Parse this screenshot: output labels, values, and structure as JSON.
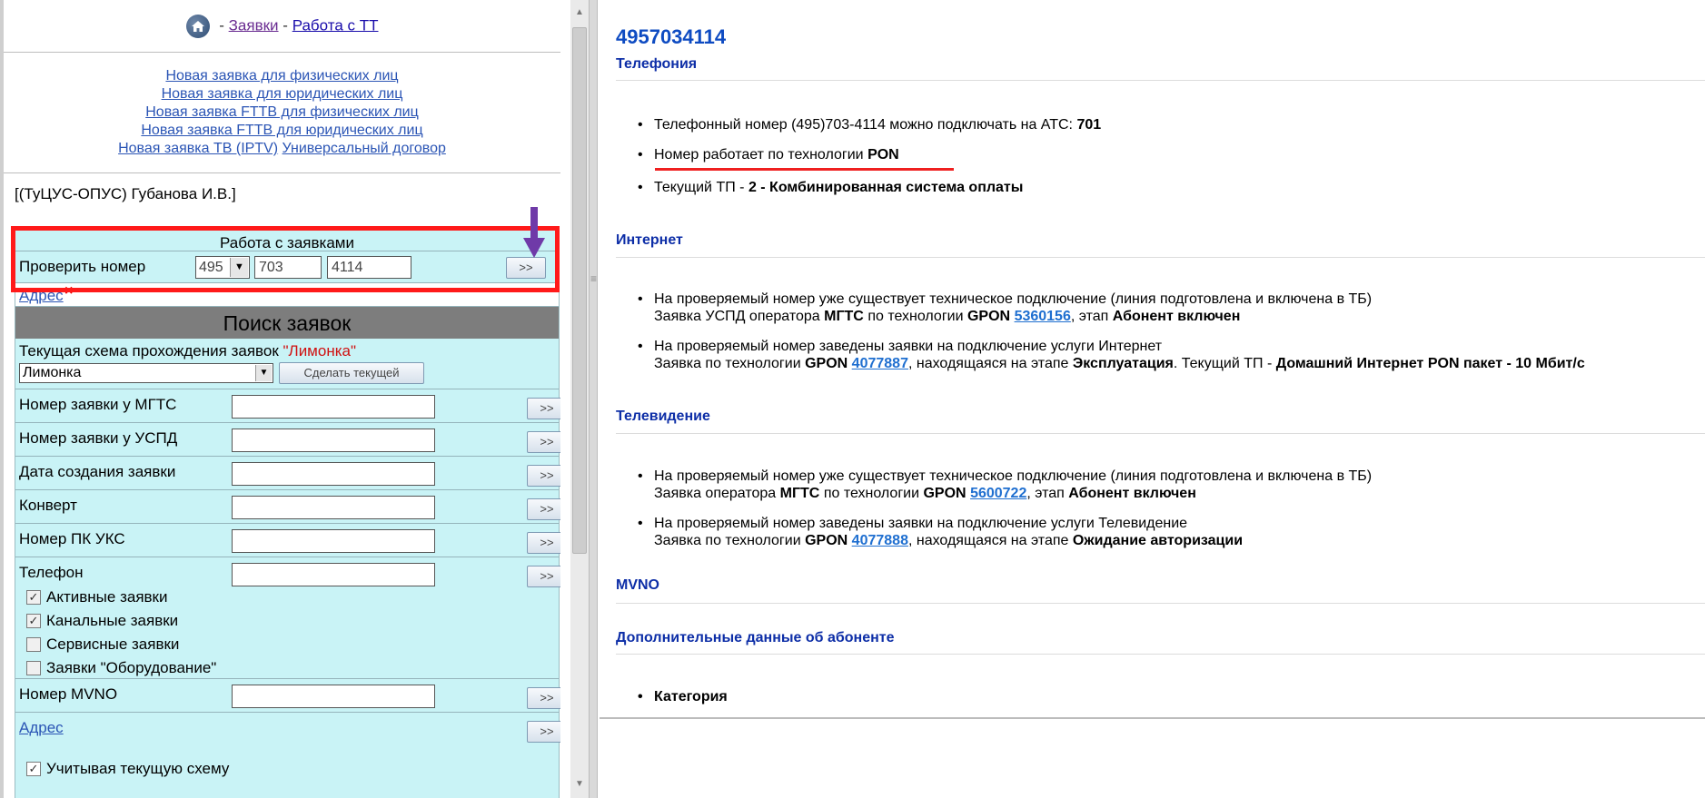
{
  "nav": {
    "sep1": "-",
    "orders": "Заявки",
    "sep2": "-",
    "tt_work": "Работа с ТТ"
  },
  "new_links": [
    "Новая заявка для физических лиц",
    "Новая заявка для юридических лиц",
    "Новая заявка FTTB для физических лиц",
    "Новая заявка FTTB для юридических лиц",
    "Новая заявка ТВ (IPTV)",
    "Универсальный договор"
  ],
  "user": "[(ТуЦУС-ОПУС) Губанова И.В.]",
  "work": {
    "title": "Работа с заявками",
    "check_label": "Проверить номер",
    "code": "495",
    "prefix": "703",
    "number": "4114",
    "go": ">>",
    "address_link": "Адрес",
    "address_x": "×"
  },
  "search": {
    "title": "Поиск заявок",
    "scheme_text": "Текущая схема прохождения заявок",
    "scheme_name": "\"Лимонка\"",
    "scheme_select": "Лимонка",
    "make_current": "Сделать текущей",
    "fields": [
      {
        "label": "Номер заявки у МГТС",
        "btn": ">>"
      },
      {
        "label": "Номер заявки у УСПД",
        "btn": ">>"
      },
      {
        "label": "Дата создания заявки",
        "btn": ">>"
      },
      {
        "label": "Конверт",
        "btn": ">>"
      },
      {
        "label": "Номер ПК УКС",
        "btn": ">>"
      },
      {
        "label": "Телефон",
        "btn": ">>"
      }
    ],
    "checks": [
      {
        "label": "Активные заявки",
        "checked": true
      },
      {
        "label": "Канальные заявки",
        "checked": true
      },
      {
        "label": "Сервисные заявки",
        "checked": false
      },
      {
        "label": "Заявки \"Оборудование\"",
        "checked": false
      }
    ],
    "mvno_label": "Номер MVNO",
    "mvno_btn": ">>",
    "address_label": "Адрес",
    "address_btn": ">>",
    "consider_scheme": "Учитывая текущую схему"
  },
  "right": {
    "phone": "4957034114",
    "telephony": {
      "title": "Телефония",
      "b1_text": "Телефонный номер (495)703-4114 можно подключать на АТС:",
      "b1_bold": "701",
      "b2_text": "Номер работает по технологии",
      "b2_bold": "PON",
      "b3_text": "Текущий ТП -",
      "b3_bold": "2 - Комбинированная система оплаты"
    },
    "internet": {
      "title": "Интернет",
      "b1_line1": "На проверяемый номер уже существует техническое подключение (линия подготовлена и включена в ТБ)",
      "b1_l2a": "Заявка УСПД оператора",
      "b1_l2b": "МГТС",
      "b1_l2c": "по технологии",
      "b1_l2d": "GPON",
      "b1_link": "5360156",
      "b1_l2e": ", этап",
      "b1_l2f": "Абонент включен",
      "b2_line1": "На проверяемый номер заведены заявки на подключение услуги Интернет",
      "b2_l2a": "Заявка по технологии",
      "b2_l2b": "GPON",
      "b2_link": "4077887",
      "b2_l2c": ", находящаяся на этапе",
      "b2_l2d": "Эксплуатация",
      "b2_l2e": ". Текущий ТП -",
      "b2_l2f": "Домашний Интернет PON пакет - 10 Мбит/с"
    },
    "tv": {
      "title": "Телевидение",
      "b1_line1": "На проверяемый номер уже существует техническое подключение (линия подготовлена и включена в ТБ)",
      "b1_l2a": "Заявка оператора",
      "b1_l2b": "МГТС",
      "b1_l2c": "по технологии",
      "b1_l2d": "GPON",
      "b1_link": "5600722",
      "b1_l2e": ", этап",
      "b1_l2f": "Абонент включен",
      "b2_line1": "На проверяемый номер заведены заявки на подключение услуги Телевидение",
      "b2_l2a": "Заявка по технологии",
      "b2_l2b": "GPON",
      "b2_link": "4077888",
      "b2_l2c": ", находящаяся на этапе",
      "b2_l2d": "Ожидание авторизации"
    },
    "mvno": {
      "title": "MVNO"
    },
    "extra": {
      "title": "Дополнительные данные об абоненте",
      "b1": "Категория"
    }
  }
}
